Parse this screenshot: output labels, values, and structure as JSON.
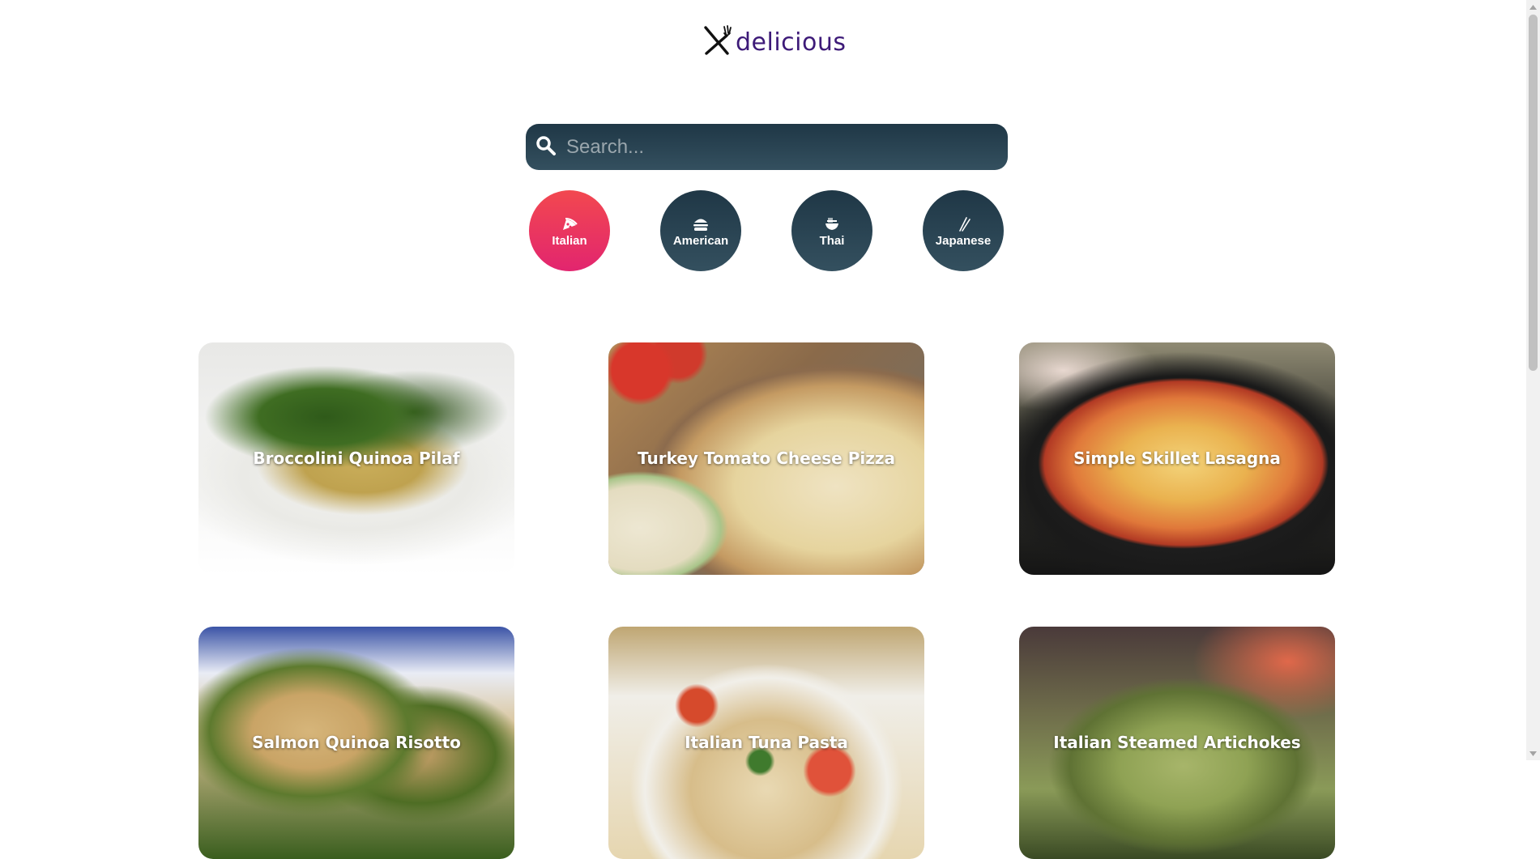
{
  "logo": {
    "text": "delicious",
    "icon": "fork-knife-icon"
  },
  "search": {
    "placeholder": "Search...",
    "value": "",
    "icon": "search-icon"
  },
  "categories": [
    {
      "label": "Italian",
      "icon": "pizza-icon",
      "active": true
    },
    {
      "label": "American",
      "icon": "burger-icon",
      "active": false
    },
    {
      "label": "Thai",
      "icon": "noodle-bowl-icon",
      "active": false
    },
    {
      "label": "Japanese",
      "icon": "chopsticks-icon",
      "active": false
    }
  ],
  "recipes": [
    {
      "title": "Broccolini Quinoa Pilaf"
    },
    {
      "title": "Turkey Tomato Cheese Pizza"
    },
    {
      "title": "Simple Skillet Lasagna"
    },
    {
      "title": "Salmon Quinoa Risotto"
    },
    {
      "title": "Italian Tuna Pasta"
    },
    {
      "title": "Italian Steamed Artichokes"
    }
  ],
  "colors": {
    "accent_gradient": [
      "#f2484f",
      "#e2256f"
    ],
    "dark_gradient": [
      "#1f3746",
      "#34505f"
    ],
    "logo": "#3d1a78"
  }
}
